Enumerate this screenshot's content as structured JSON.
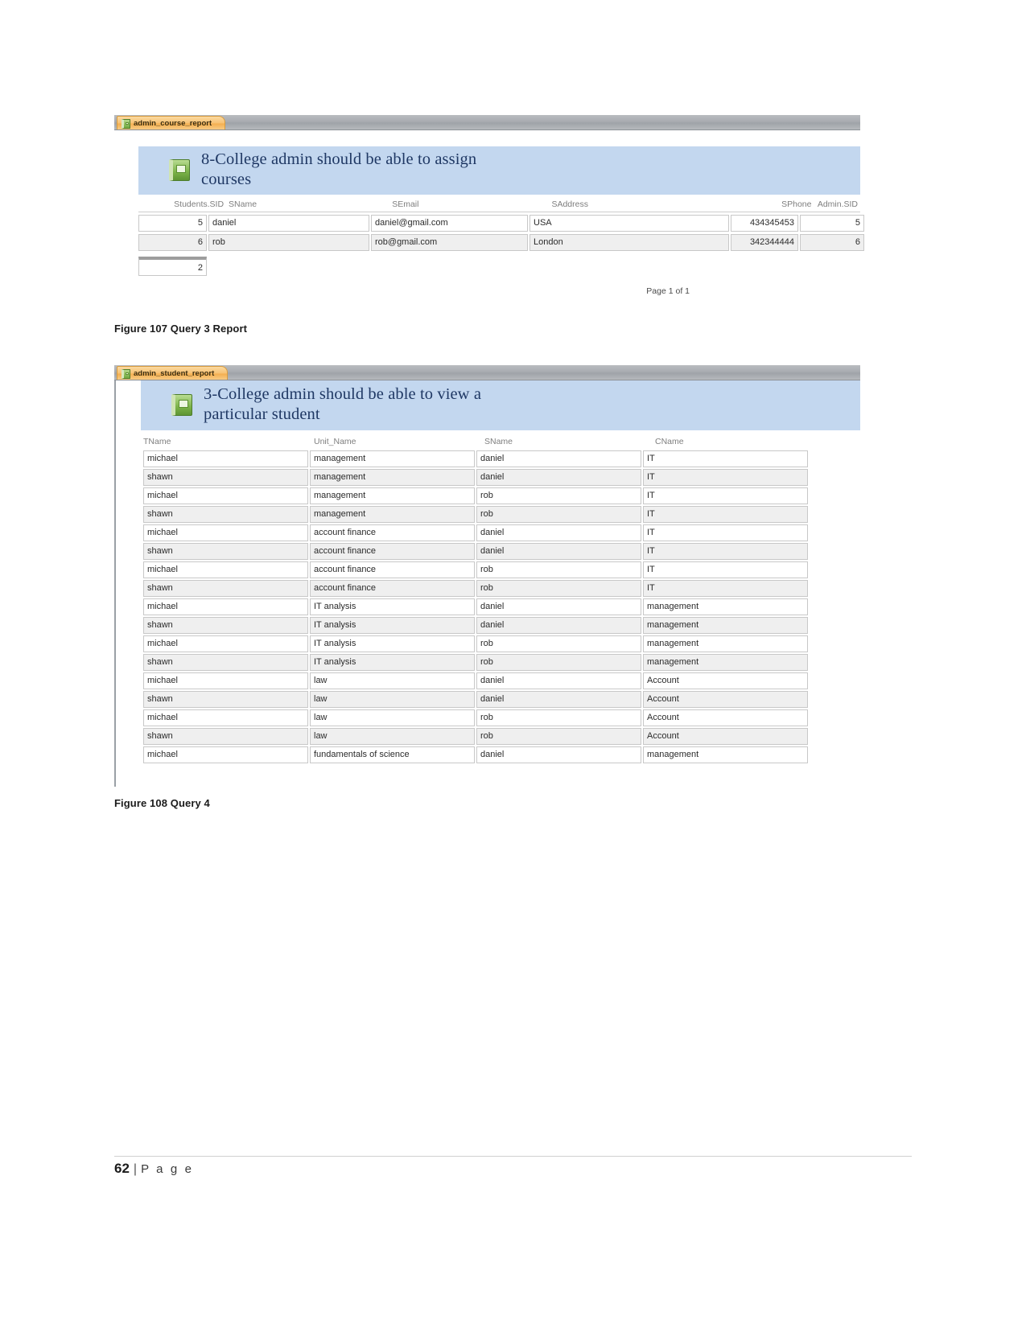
{
  "reports": [
    {
      "tab_label": "admin_course_report",
      "tab_icon": "report-icon",
      "heading": "8-College admin should be able to assign courses",
      "columns": [
        {
          "label": "Students.SID",
          "align": "right"
        },
        {
          "label": "SName",
          "align": "left"
        },
        {
          "label": "SEmail",
          "align": "left"
        },
        {
          "label": "SAddress",
          "align": "left"
        },
        {
          "label": "SPhone",
          "align": "right"
        },
        {
          "label": "Admin.SID",
          "align": "right"
        }
      ],
      "rows": [
        [
          "5",
          "daniel",
          "daniel@gmail.com",
          "USA",
          "434345453",
          "5"
        ],
        [
          "6",
          "rob",
          "rob@gmail.com",
          "London",
          "342344444",
          "6"
        ]
      ],
      "summary_value": "2",
      "page_footer": "Page 1 of 1"
    },
    {
      "tab_label": "admin_student_report",
      "tab_icon": "report-icon",
      "heading": "3-College admin should be able to view a particular student",
      "columns": [
        {
          "label": "TName",
          "align": "left"
        },
        {
          "label": "Unit_Name",
          "align": "left"
        },
        {
          "label": "SName",
          "align": "left"
        },
        {
          "label": "CName",
          "align": "left"
        }
      ],
      "rows": [
        [
          "michael",
          "management",
          "daniel",
          "IT"
        ],
        [
          "shawn",
          "management",
          "daniel",
          "IT"
        ],
        [
          "michael",
          "management",
          "rob",
          "IT"
        ],
        [
          "shawn",
          "management",
          "rob",
          "IT"
        ],
        [
          "michael",
          "account finance",
          "daniel",
          "IT"
        ],
        [
          "shawn",
          "account finance",
          "daniel",
          "IT"
        ],
        [
          "michael",
          "account finance",
          "rob",
          "IT"
        ],
        [
          "shawn",
          "account finance",
          "rob",
          "IT"
        ],
        [
          "michael",
          "IT analysis",
          "daniel",
          "management"
        ],
        [
          "shawn",
          "IT analysis",
          "daniel",
          "management"
        ],
        [
          "michael",
          "IT analysis",
          "rob",
          "management"
        ],
        [
          "shawn",
          "IT analysis",
          "rob",
          "management"
        ],
        [
          "michael",
          "law",
          "daniel",
          "Account"
        ],
        [
          "shawn",
          "law",
          "daniel",
          "Account"
        ],
        [
          "michael",
          "law",
          "rob",
          "Account"
        ],
        [
          "shawn",
          "law",
          "rob",
          "Account"
        ],
        [
          "michael",
          "fundamentals of science",
          "daniel",
          "management"
        ]
      ]
    }
  ],
  "captions": [
    "Figure 107 Query 3 Report",
    "Figure 108 Query 4"
  ],
  "footer": {
    "page_number": "62",
    "separator": "|",
    "page_word": "P a g e"
  }
}
